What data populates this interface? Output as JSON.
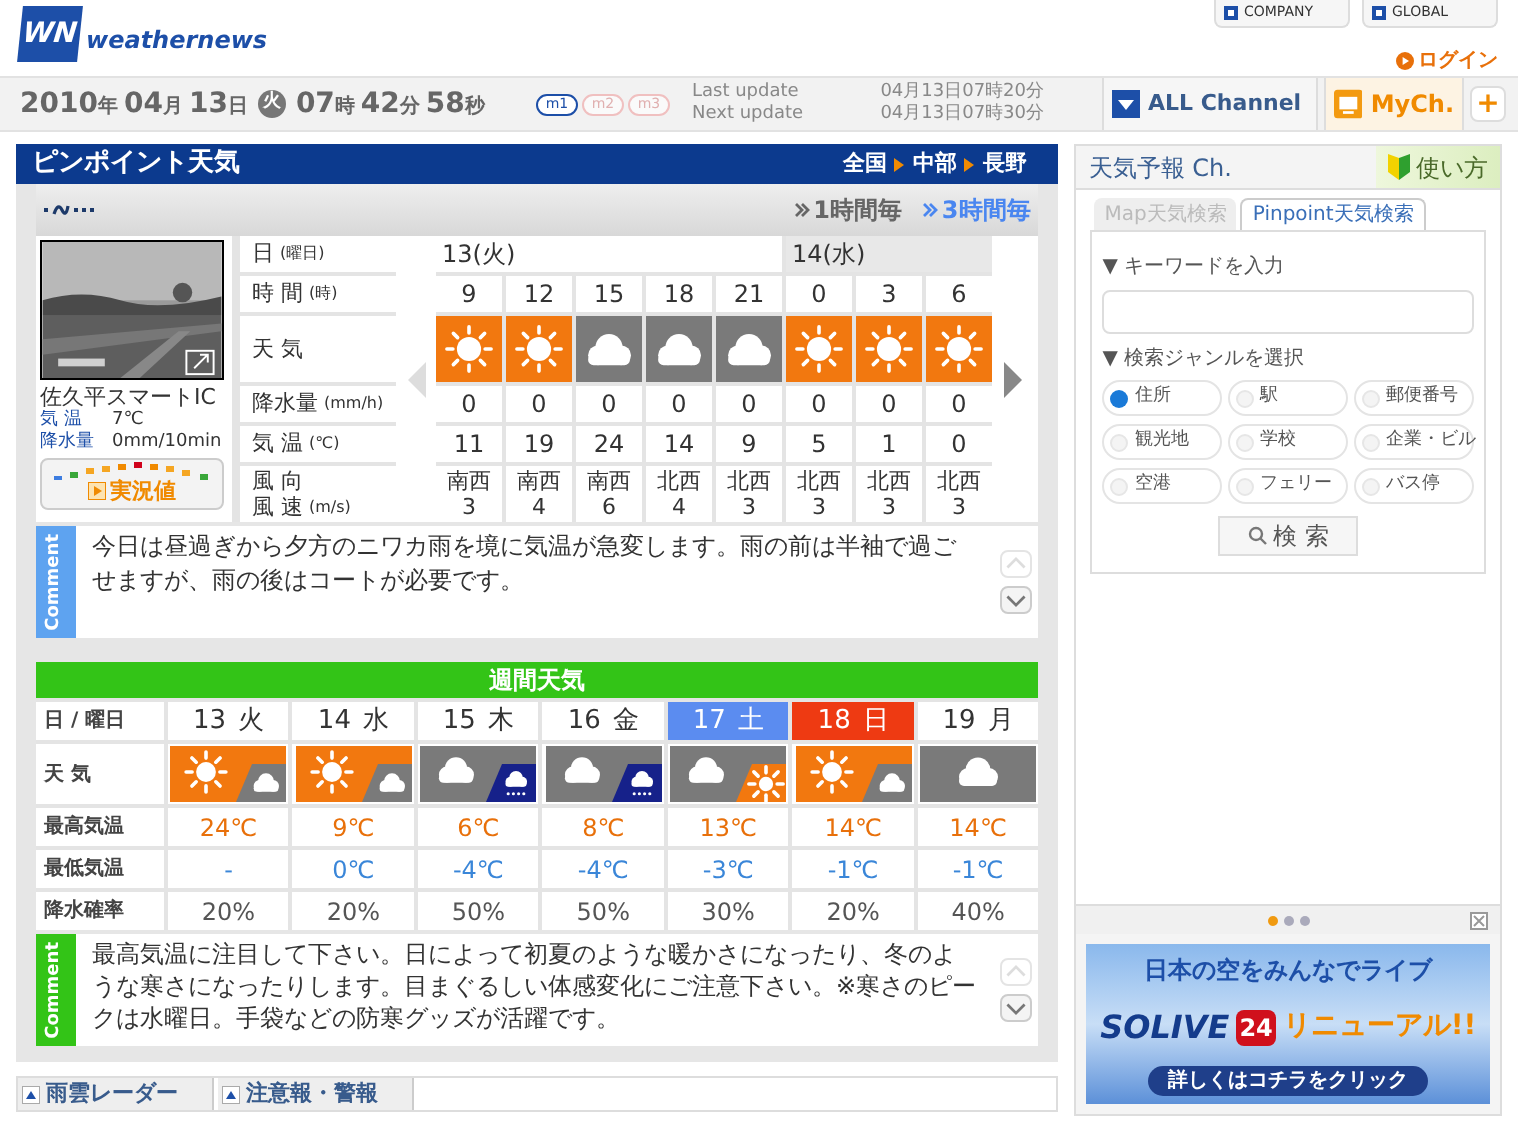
{
  "header": {
    "logo": {
      "mark": "WN",
      "name": "weathernews"
    },
    "links": [
      {
        "label": "COMPANY"
      },
      {
        "label": "GLOBAL"
      }
    ],
    "login": "ログイン"
  },
  "datebar": {
    "date": [
      {
        "value": "2010",
        "unit": "年"
      },
      {
        "value": "04",
        "unit": "月"
      },
      {
        "value": "13",
        "unit": "日"
      }
    ],
    "weekday": "火",
    "time": [
      {
        "value": "07",
        "unit": "時"
      },
      {
        "value": "42",
        "unit": "分"
      },
      {
        "value": "58",
        "unit": "秒"
      }
    ],
    "modes": [
      {
        "label": "m1",
        "selected": true
      },
      {
        "label": "m2",
        "selected": false
      },
      {
        "label": "m3",
        "selected": false
      }
    ],
    "updates": [
      {
        "label": "Last update",
        "value": "04月13日07時20分"
      },
      {
        "label": "Next update",
        "value": "04月13日07時30分"
      }
    ],
    "channels": [
      {
        "label": "ALL Channel",
        "kind": "all"
      },
      {
        "label": "MyCh.",
        "kind": "my"
      }
    ],
    "add_button": "+"
  },
  "pinpoint": {
    "title": "ピンポイント天気",
    "breadcrumbs": [
      "全国",
      "中部",
      "長野"
    ],
    "intervals": [
      {
        "label": "1時間毎",
        "selected": false
      },
      {
        "label": "3時間毎",
        "selected": true
      }
    ],
    "station": {
      "name": "佐久平スマートIC",
      "readings": [
        {
          "label": "気 温",
          "value": "7℃"
        },
        {
          "label": "降水量",
          "value": "0mm/10min"
        }
      ],
      "live_button": "実況値"
    },
    "row_labels": [
      {
        "label": "日",
        "unit": "(曜日)"
      },
      {
        "label": "時 間",
        "unit": "(時)"
      },
      {
        "label": "天 気"
      },
      {
        "label": "降水量",
        "unit": "(mm/h)"
      },
      {
        "label": "気 温",
        "unit": "(℃)"
      },
      {
        "lines": [
          "風 向",
          "風 速"
        ],
        "unit": "(m/s)"
      }
    ],
    "days": [
      {
        "label": "13(火)",
        "hours": [
          {
            "time": "9",
            "kind": "sun",
            "precip": "0",
            "temp": "11",
            "wind_dir": "南西",
            "wind_speed": "3"
          },
          {
            "time": "12",
            "kind": "sun",
            "precip": "0",
            "temp": "19",
            "wind_dir": "南西",
            "wind_speed": "4"
          },
          {
            "time": "15",
            "kind": "cloud",
            "precip": "0",
            "temp": "24",
            "wind_dir": "南西",
            "wind_speed": "6"
          },
          {
            "time": "18",
            "kind": "cloud",
            "precip": "0",
            "temp": "14",
            "wind_dir": "北西",
            "wind_speed": "4"
          },
          {
            "time": "21",
            "kind": "cloud",
            "precip": "0",
            "temp": "9",
            "wind_dir": "北西",
            "wind_speed": "3"
          }
        ]
      },
      {
        "label": "14(水)",
        "hours": [
          {
            "time": "0",
            "kind": "sun",
            "precip": "0",
            "temp": "5",
            "wind_dir": "北西",
            "wind_speed": "3"
          },
          {
            "time": "3",
            "kind": "sun",
            "precip": "0",
            "temp": "1",
            "wind_dir": "北西",
            "wind_speed": "3"
          },
          {
            "time": "6",
            "kind": "sun",
            "precip": "0",
            "temp": "0",
            "wind_dir": "北西",
            "wind_speed": "3"
          }
        ]
      }
    ],
    "comment": {
      "tag": "Comment",
      "text": "今日は昼過ぎから夕方のニワカ雨を境に気温が急変します。雨の前は半袖で過ごせますが、雨の後はコートが必要です。"
    }
  },
  "weekly": {
    "title": "週間天気",
    "header_label": "日 / 曜日",
    "row_labels": [
      "天 気",
      "最高気温",
      "最低気温",
      "降水確率"
    ],
    "days": [
      {
        "date": "13",
        "weekday": "火",
        "kind": "weekday",
        "icons": [
          {
            "kind": "sun"
          },
          {
            "kind": "cloud"
          }
        ],
        "high": "24℃",
        "low": "-",
        "pop": "20%"
      },
      {
        "date": "14",
        "weekday": "水",
        "kind": "weekday",
        "icons": [
          {
            "kind": "sun"
          },
          {
            "kind": "cloud"
          }
        ],
        "high": "9℃",
        "low": "0℃",
        "pop": "20%"
      },
      {
        "date": "15",
        "weekday": "木",
        "kind": "weekday",
        "icons": [
          {
            "kind": "cloud"
          },
          {
            "kind": "rain"
          }
        ],
        "high": "6℃",
        "low": "-4℃",
        "pop": "50%"
      },
      {
        "date": "16",
        "weekday": "金",
        "kind": "weekday",
        "icons": [
          {
            "kind": "cloud"
          },
          {
            "kind": "rain"
          }
        ],
        "high": "8℃",
        "low": "-4℃",
        "pop": "50%"
      },
      {
        "date": "17",
        "weekday": "土",
        "kind": "saturday",
        "icons": [
          {
            "kind": "cloud"
          },
          {
            "kind": "sun"
          }
        ],
        "high": "13℃",
        "low": "-3℃",
        "pop": "30%"
      },
      {
        "date": "18",
        "weekday": "日",
        "kind": "sunday",
        "icons": [
          {
            "kind": "sun"
          },
          {
            "kind": "cloud"
          }
        ],
        "high": "14℃",
        "low": "-1℃",
        "pop": "20%"
      },
      {
        "date": "19",
        "weekday": "月",
        "kind": "weekday",
        "icons": [
          {
            "kind": "cloud"
          }
        ],
        "high": "14℃",
        "low": "-1℃",
        "pop": "40%"
      }
    ],
    "comment": {
      "tag": "Comment",
      "text": "最高気温に注目して下さい。日によって初夏のような暖かさになったり、冬のような寒さになったりします。目まぐるしい体感変化にご注意下さい。※寒さのピークは水曜日。手袋などの防寒グッズが活躍です。"
    }
  },
  "bottom_tabs": [
    "雨雲レーダー",
    "注意報・警報"
  ],
  "search": {
    "title": "天気予報 Ch.",
    "help": "使い方",
    "tabs": [
      {
        "label": "Map天気検索",
        "selected": false
      },
      {
        "label": "Pinpoint天気検索",
        "selected": true
      }
    ],
    "keyword_label": "▼ キーワードを入力",
    "genre_label": "▼ 検索ジャンルを選択",
    "genres": [
      {
        "label": "住所",
        "selected": true
      },
      {
        "label": "駅",
        "selected": false
      },
      {
        "label": "郵便番号",
        "selected": false
      },
      {
        "label": "観光地",
        "selected": false
      },
      {
        "label": "学校",
        "selected": false
      },
      {
        "label": "企業・ビル",
        "selected": false
      },
      {
        "label": "空港",
        "selected": false
      },
      {
        "label": "フェリー",
        "selected": false
      },
      {
        "label": "バス停",
        "selected": false
      }
    ],
    "button": "検 索"
  },
  "pager": [
    {
      "selected": true
    },
    {
      "selected": false
    },
    {
      "selected": false
    }
  ],
  "banner": {
    "headline": "日本の空をみんなでライブ",
    "brand": "SOLIVE",
    "brand_number": "24",
    "tagline": "リニューアル!!",
    "cta": "詳しくはコチラをクリック"
  }
}
